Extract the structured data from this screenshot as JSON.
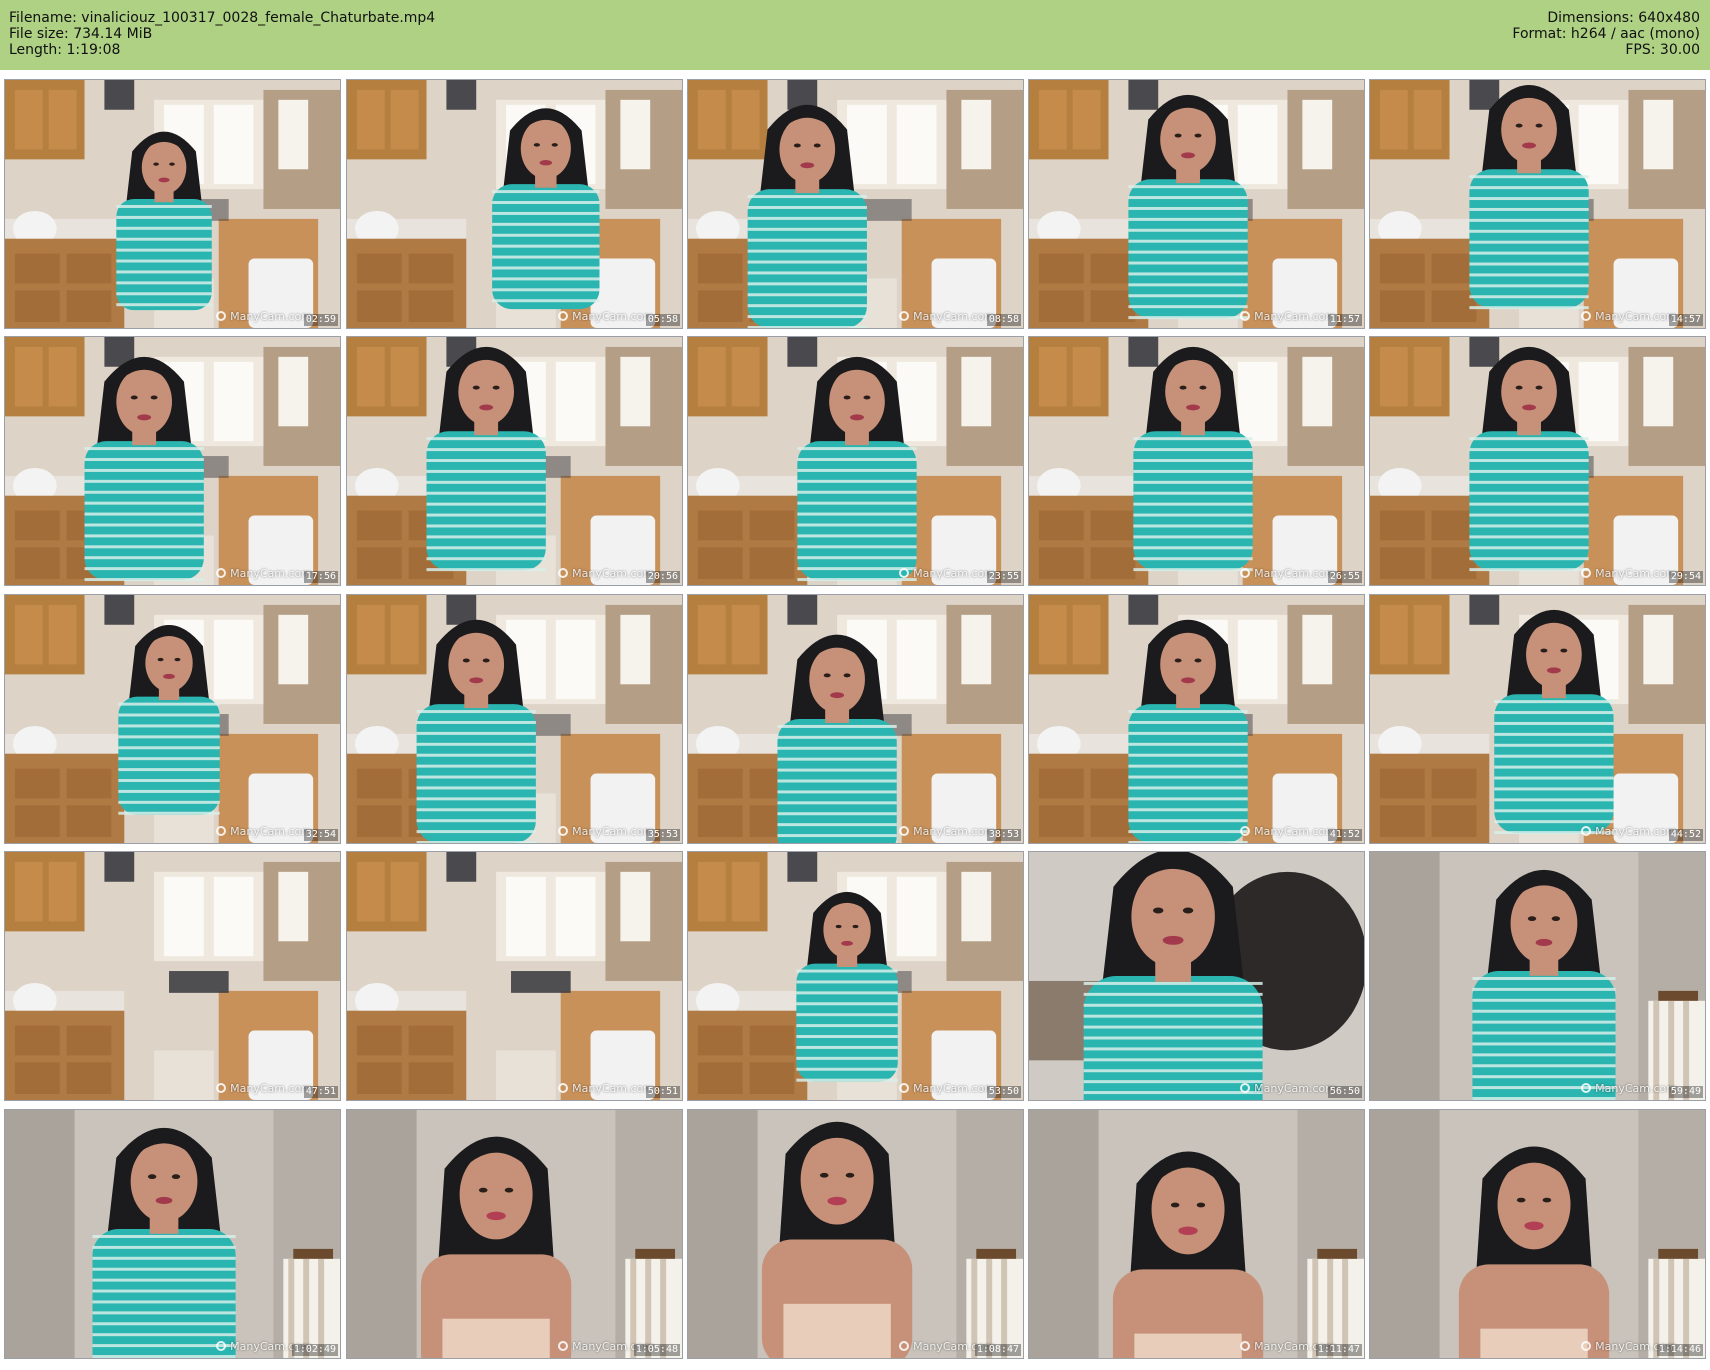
{
  "header": {
    "filename": "Filename: vinaliciouz_100317_0028_female_Chaturbate.mp4",
    "filesize": "File size: 734.14 MiB",
    "length": "Length: 1:19:08",
    "dimensions": "Dimensions: 640x480",
    "format": "Format: h264 / aac (mono)",
    "fps": "FPS: 30.00"
  },
  "watermark": "ManyCam.com",
  "colors": {
    "header_bg": "#aed184",
    "shirt": "#2bb5b0",
    "hair": "#1b1a1c",
    "skin": "#c69178",
    "cabinet": "#b07a45",
    "wall_pale": "#e7ddd2"
  },
  "thumbnails": [
    {
      "time": "02:59",
      "scene": "kitchen"
    },
    {
      "time": "05:58",
      "scene": "kitchen"
    },
    {
      "time": "08:58",
      "scene": "kitchen"
    },
    {
      "time": "11:57",
      "scene": "kitchen"
    },
    {
      "time": "14:57",
      "scene": "kitchen"
    },
    {
      "time": "17:56",
      "scene": "kitchen"
    },
    {
      "time": "20:56",
      "scene": "kitchen"
    },
    {
      "time": "23:55",
      "scene": "kitchen"
    },
    {
      "time": "26:55",
      "scene": "kitchen"
    },
    {
      "time": "29:54",
      "scene": "kitchen"
    },
    {
      "time": "32:54",
      "scene": "kitchen"
    },
    {
      "time": "35:53",
      "scene": "kitchen"
    },
    {
      "time": "38:53",
      "scene": "kitchen"
    },
    {
      "time": "41:52",
      "scene": "kitchen"
    },
    {
      "time": "44:52",
      "scene": "kitchen"
    },
    {
      "time": "47:51",
      "scene": "kitchen-empty"
    },
    {
      "time": "50:51",
      "scene": "kitchen-empty"
    },
    {
      "time": "53:50",
      "scene": "kitchen"
    },
    {
      "time": "56:50",
      "scene": "closeup"
    },
    {
      "time": "59:49",
      "scene": "hallway"
    },
    {
      "time": "1:02:49",
      "scene": "hallway"
    },
    {
      "time": "1:05:48",
      "scene": "hallway-tank"
    },
    {
      "time": "1:08:47",
      "scene": "hallway-tank"
    },
    {
      "time": "1:11:47",
      "scene": "hallway-tank"
    },
    {
      "time": "1:14:46",
      "scene": "hallway-tank"
    }
  ]
}
